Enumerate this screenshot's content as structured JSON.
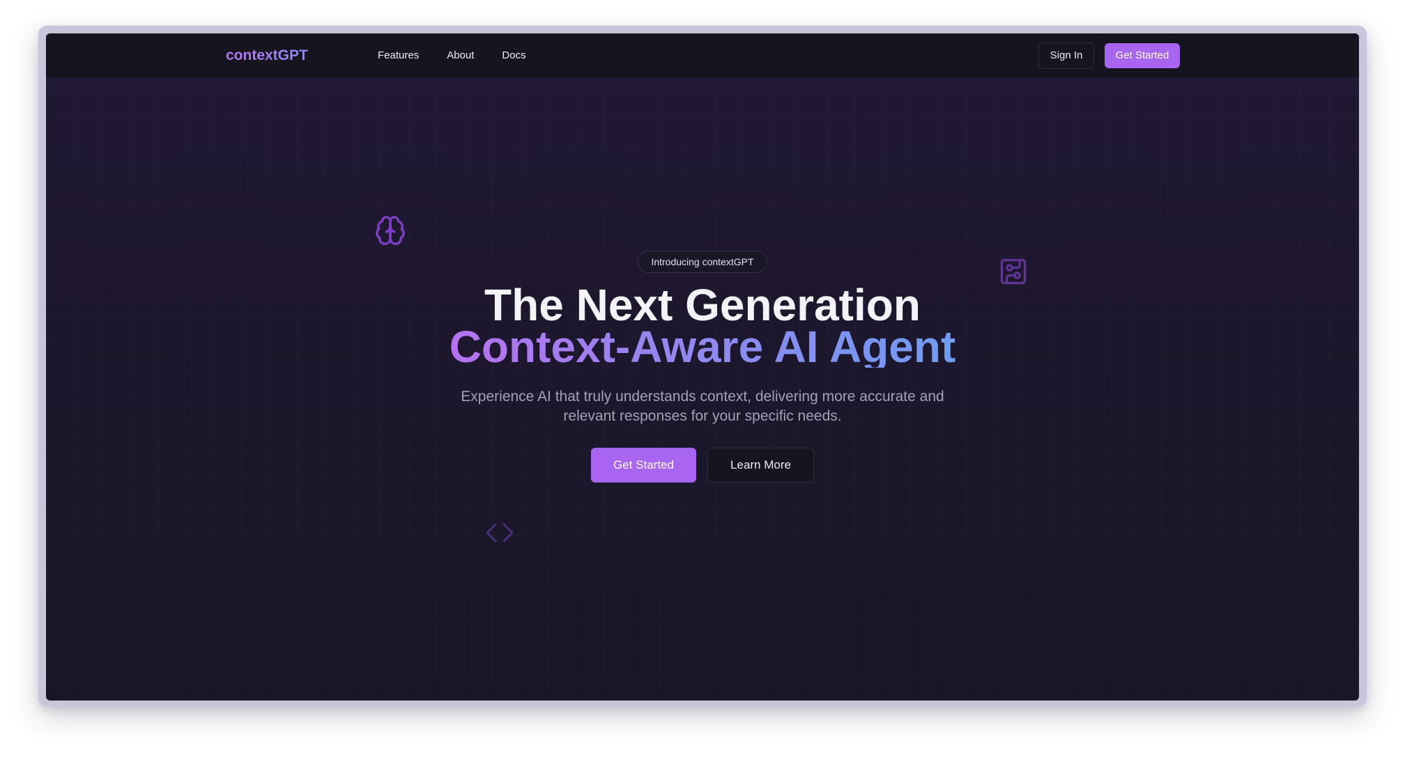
{
  "nav": {
    "brand": "contextGPT",
    "links": [
      {
        "label": "Features"
      },
      {
        "label": "About"
      },
      {
        "label": "Docs"
      }
    ],
    "sign_in_label": "Sign In",
    "get_started_label": "Get Started"
  },
  "hero": {
    "badge": "Introducing contextGPT",
    "title_line1": "The Next Generation",
    "title_line2": "Context-Aware AI Agent",
    "subtitle": "Experience AI that truly understands context, delivering more accurate and relevant responses for your specific needs.",
    "primary_cta": "Get Started",
    "secondary_cta": "Learn More"
  },
  "decorations": {
    "icons": [
      "brain-icon",
      "circuit-board-icon",
      "code-icon"
    ]
  },
  "colors": {
    "accent": "#a865f0",
    "gradient_start": "#b672f0",
    "gradient_end": "#6f9cf2",
    "background": "#1d172d",
    "navbar_bg": "#15141f"
  }
}
